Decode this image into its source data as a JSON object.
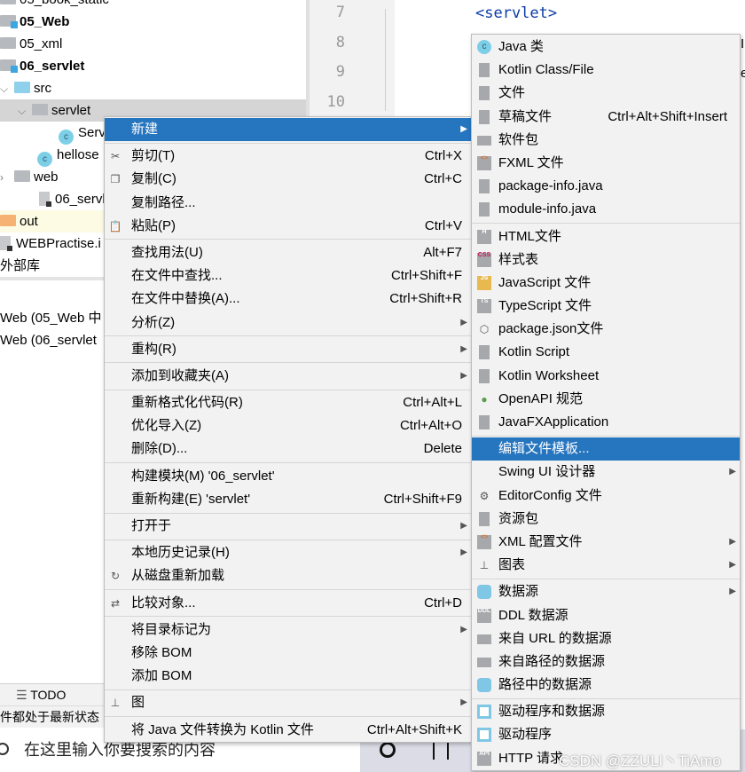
{
  "project_tree": [
    {
      "label": "05_book_static",
      "bold": false,
      "icon": "module-folder-icon"
    },
    {
      "label": "05_Web",
      "bold": true,
      "icon": "module-folder-icon"
    },
    {
      "label": "05_xml",
      "bold": false,
      "icon": "folder-icon"
    },
    {
      "label": "06_servlet",
      "bold": true,
      "icon": "module-folder-icon"
    },
    {
      "label": "src",
      "bold": false,
      "icon": "source-folder-icon",
      "chevron": "v"
    },
    {
      "label": "servlet",
      "bold": false,
      "icon": "package-icon",
      "chevron": "v",
      "selected": true
    },
    {
      "label": "Serv",
      "bold": false,
      "icon": "java-class-icon"
    },
    {
      "label": "hellose",
      "bold": false,
      "icon": "java-class-icon"
    },
    {
      "label": "web",
      "bold": false,
      "icon": "web-folder-icon",
      "chevron": ">"
    },
    {
      "label": "06_servlet",
      "bold": false,
      "icon": "iml-file-icon"
    },
    {
      "label": "out",
      "bold": false,
      "icon": "out-folder-icon"
    },
    {
      "label": "WEBPractise.i",
      "bold": false,
      "icon": "iml-file-icon"
    },
    {
      "label": "外部库",
      "bold": false,
      "icon": ""
    }
  ],
  "services": [
    "Web (05_Web 中",
    "Web (06_servlet"
  ],
  "editor": {
    "line_numbers": [
      "7",
      "8",
      "9",
      "10"
    ],
    "code_line": "<servlet>",
    "edge_chars": [
      "I",
      "e"
    ]
  },
  "bottom_toolbar": {
    "todo": "TODO"
  },
  "status_bar": {
    "text": "件都处于最新状态"
  },
  "taskbar": {
    "search_placeholder": "在这里输入你要搜索的内容"
  },
  "watermark": "CSDN @ZZULI丶TiAmo",
  "colors": {
    "highlight": "#2675bf",
    "menu_bg": "#f2f2f2"
  },
  "context_menu": [
    {
      "label": "新建",
      "arrow": true,
      "highlighted": true
    },
    {
      "sep": true
    },
    {
      "label": "剪切(T)",
      "shortcut": "Ctrl+X",
      "icon": "scissors-icon"
    },
    {
      "label": "复制(C)",
      "shortcut": "Ctrl+C",
      "icon": "copy-icon"
    },
    {
      "label": "复制路径..."
    },
    {
      "label": "粘贴(P)",
      "shortcut": "Ctrl+V",
      "icon": "paste-icon"
    },
    {
      "sep": true
    },
    {
      "label": "查找用法(U)",
      "shortcut": "Alt+F7"
    },
    {
      "label": "在文件中查找...",
      "shortcut": "Ctrl+Shift+F"
    },
    {
      "label": "在文件中替换(A)...",
      "shortcut": "Ctrl+Shift+R"
    },
    {
      "label": "分析(Z)",
      "arrow": true
    },
    {
      "sep": true
    },
    {
      "label": "重构(R)",
      "arrow": true
    },
    {
      "sep": true
    },
    {
      "label": "添加到收藏夹(A)",
      "arrow": true
    },
    {
      "sep": true
    },
    {
      "label": "重新格式化代码(R)",
      "shortcut": "Ctrl+Alt+L"
    },
    {
      "label": "优化导入(Z)",
      "shortcut": "Ctrl+Alt+O"
    },
    {
      "label": "删除(D)...",
      "shortcut": "Delete"
    },
    {
      "sep": true
    },
    {
      "label": "构建模块(M) '06_servlet'"
    },
    {
      "label": "重新构建(E) 'servlet'",
      "shortcut": "Ctrl+Shift+F9"
    },
    {
      "sep": true
    },
    {
      "label": "打开于",
      "arrow": true
    },
    {
      "sep": true
    },
    {
      "label": "本地历史记录(H)",
      "arrow": true
    },
    {
      "label": "从磁盘重新加载",
      "icon": "reload-icon"
    },
    {
      "sep": true
    },
    {
      "label": "比较对象...",
      "shortcut": "Ctrl+D",
      "icon": "compare-icon"
    },
    {
      "sep": true
    },
    {
      "label": "将目录标记为",
      "arrow": true
    },
    {
      "label": "移除 BOM"
    },
    {
      "label": "添加 BOM"
    },
    {
      "sep": true
    },
    {
      "label": "图",
      "arrow": true,
      "icon": "diagram-icon"
    },
    {
      "sep": true
    },
    {
      "label": "将 Java 文件转换为 Kotlin 文件",
      "shortcut": "Ctrl+Alt+Shift+K"
    }
  ],
  "new_submenu": [
    {
      "label": "Java 类",
      "icon": "java-class-icon"
    },
    {
      "label": "Kotlin Class/File",
      "icon": "kotlin-file-icon"
    },
    {
      "label": "文件",
      "icon": "file-icon"
    },
    {
      "label": "草稿文件",
      "shortcut": "Ctrl+Alt+Shift+Insert",
      "icon": "scratch-file-icon"
    },
    {
      "label": "软件包",
      "icon": "package-icon"
    },
    {
      "label": "FXML 文件",
      "icon": "fxml-file-icon"
    },
    {
      "label": "package-info.java",
      "icon": "java-file-icon"
    },
    {
      "label": "module-info.java",
      "icon": "java-file-icon"
    },
    {
      "sep": true
    },
    {
      "label": "HTML文件",
      "icon": "html-file-icon"
    },
    {
      "label": "样式表",
      "icon": "css-file-icon"
    },
    {
      "label": "JavaScript 文件",
      "icon": "js-file-icon"
    },
    {
      "label": "TypeScript 文件",
      "icon": "ts-file-icon"
    },
    {
      "label": "package.json文件",
      "icon": "nodejs-icon"
    },
    {
      "label": "Kotlin Script",
      "icon": "kotlin-script-icon"
    },
    {
      "label": "Kotlin Worksheet",
      "icon": "kotlin-worksheet-icon"
    },
    {
      "label": "OpenAPI 规范",
      "icon": "openapi-icon"
    },
    {
      "label": "JavaFXApplication",
      "icon": "java-file-icon"
    },
    {
      "sep": true
    },
    {
      "label": "编辑文件模板...",
      "highlighted": true
    },
    {
      "label": "Swing UI 设计器",
      "arrow": true
    },
    {
      "label": "EditorConfig 文件",
      "icon": "gear-icon"
    },
    {
      "label": "资源包",
      "icon": "resource-bundle-icon"
    },
    {
      "label": "XML 配置文件",
      "arrow": true,
      "icon": "xml-file-icon"
    },
    {
      "label": "图表",
      "arrow": true,
      "icon": "diagram-icon"
    },
    {
      "sep": true
    },
    {
      "label": "数据源",
      "arrow": true,
      "icon": "database-icon"
    },
    {
      "label": "DDL 数据源",
      "icon": "ddl-icon"
    },
    {
      "label": "来自 URL 的数据源",
      "icon": "url-datasource-icon"
    },
    {
      "label": "来自路径的数据源",
      "icon": "folder-icon"
    },
    {
      "label": "路径中的数据源",
      "icon": "database-icon"
    },
    {
      "sep": true
    },
    {
      "label": "驱动程序和数据源",
      "icon": "driver-icon"
    },
    {
      "label": "驱动程序",
      "icon": "driver-icon"
    },
    {
      "label": "HTTP 请求",
      "icon": "api-icon"
    }
  ]
}
